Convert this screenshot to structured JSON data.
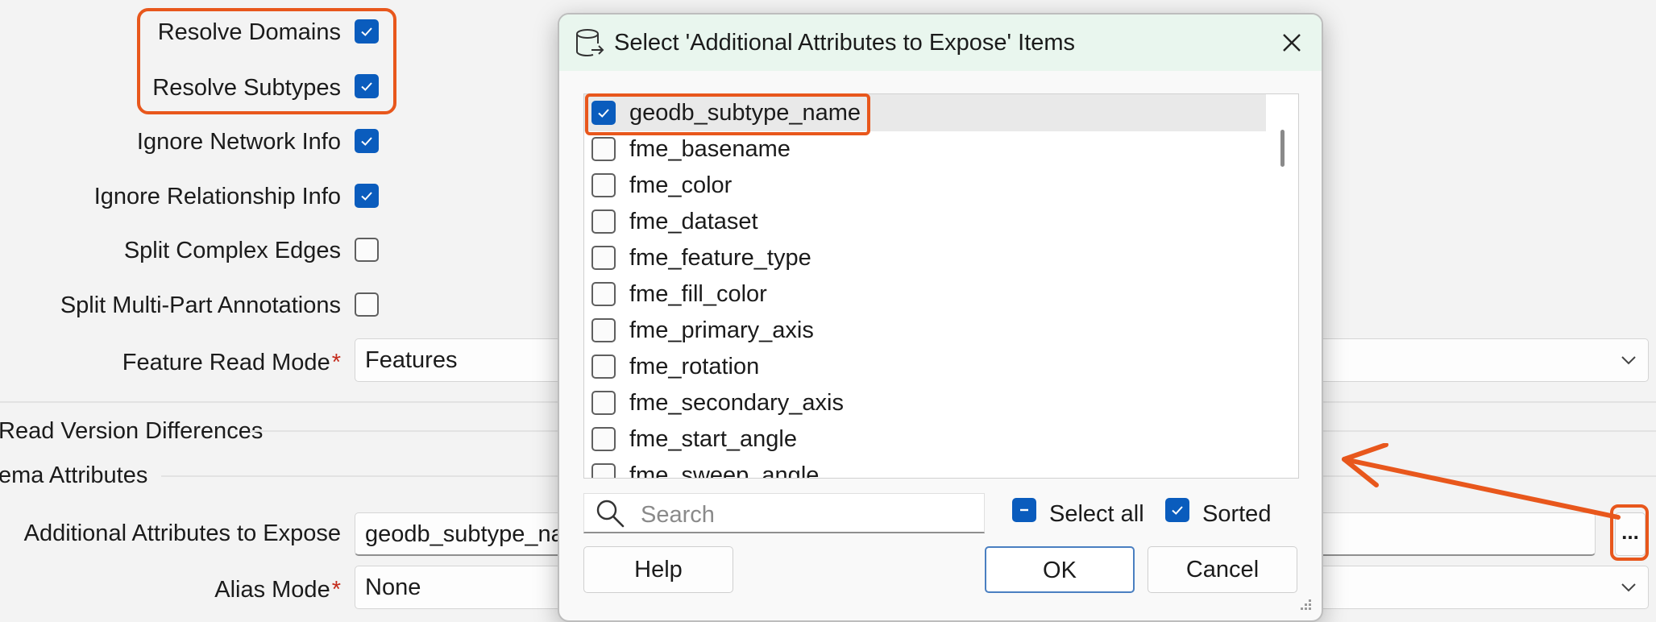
{
  "settings": {
    "resolve_domains": {
      "label": "Resolve Domains",
      "checked": true
    },
    "resolve_subtypes": {
      "label": "Resolve Subtypes",
      "checked": true
    },
    "ignore_network_info": {
      "label": "Ignore Network Info",
      "checked": true
    },
    "ignore_relationship_info": {
      "label": "Ignore Relationship Info",
      "checked": true
    },
    "split_complex_edges": {
      "label": "Split Complex Edges",
      "checked": false
    },
    "split_multipart_annotations": {
      "label": "Split Multi-Part Annotations",
      "checked": false
    },
    "feature_read_mode": {
      "label": "Feature Read Mode",
      "required_mark": "*",
      "value": "Features"
    },
    "read_version_differences": {
      "label": "Read Version Differences"
    },
    "schema_attributes": {
      "label": "ema Attributes"
    },
    "additional_attributes": {
      "label": "Additional Attributes to Expose",
      "value": "geodb_subtype_name",
      "browse_label": "..."
    },
    "alias_mode": {
      "label": "Alias Mode",
      "required_mark": "*",
      "value": "None"
    }
  },
  "dialog": {
    "title": "Select 'Additional Attributes to Expose' Items",
    "items": [
      {
        "label": "geodb_subtype_name",
        "checked": true
      },
      {
        "label": "fme_basename",
        "checked": false
      },
      {
        "label": "fme_color",
        "checked": false
      },
      {
        "label": "fme_dataset",
        "checked": false
      },
      {
        "label": "fme_feature_type",
        "checked": false
      },
      {
        "label": "fme_fill_color",
        "checked": false
      },
      {
        "label": "fme_primary_axis",
        "checked": false
      },
      {
        "label": "fme_rotation",
        "checked": false
      },
      {
        "label": "fme_secondary_axis",
        "checked": false
      },
      {
        "label": "fme_start_angle",
        "checked": false
      },
      {
        "label": "fme_sweep_angle",
        "checked": false
      }
    ],
    "search_placeholder": "Search",
    "select_all": {
      "label": "Select all",
      "state": "indeterminate"
    },
    "sorted": {
      "label": "Sorted",
      "checked": true
    },
    "help_label": "Help",
    "ok_label": "OK",
    "cancel_label": "Cancel"
  },
  "colors": {
    "accent": "#0a5cbd",
    "highlight": "#e8571c",
    "title_bar": "#e9f6ee",
    "required": "#c42b1c"
  }
}
